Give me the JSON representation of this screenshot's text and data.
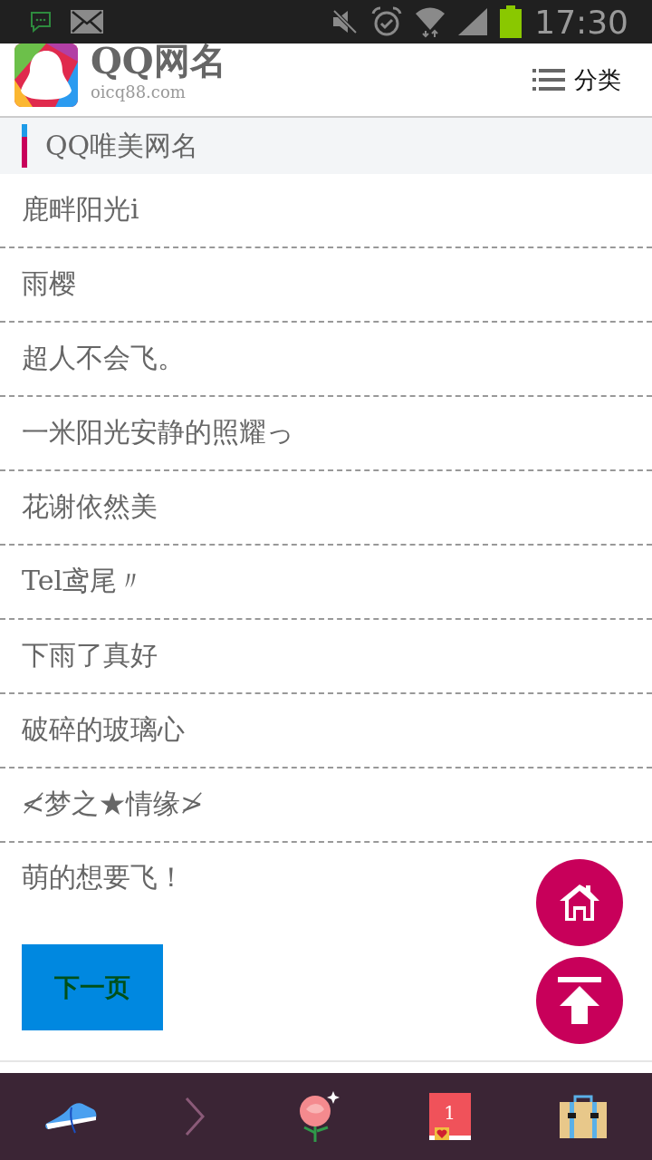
{
  "status_bar": {
    "time": "17:30"
  },
  "header": {
    "title": "QQ网名",
    "subtitle": "oicq88.com",
    "menu_label": "分类"
  },
  "section": {
    "title": "QQ唯美网名"
  },
  "names": [
    "鹿畔阳光i",
    "雨樱",
    "超人不会飞。",
    "一米阳光安静的照耀っ",
    "花谢依然美",
    "Tel鸢尾〃",
    "下雨了真好",
    "破碎的玻璃心",
    "≮梦之★情缘≯",
    "萌的想要飞！"
  ],
  "next_button": "下一页",
  "bottom_bar": {
    "book_badge": "1"
  }
}
